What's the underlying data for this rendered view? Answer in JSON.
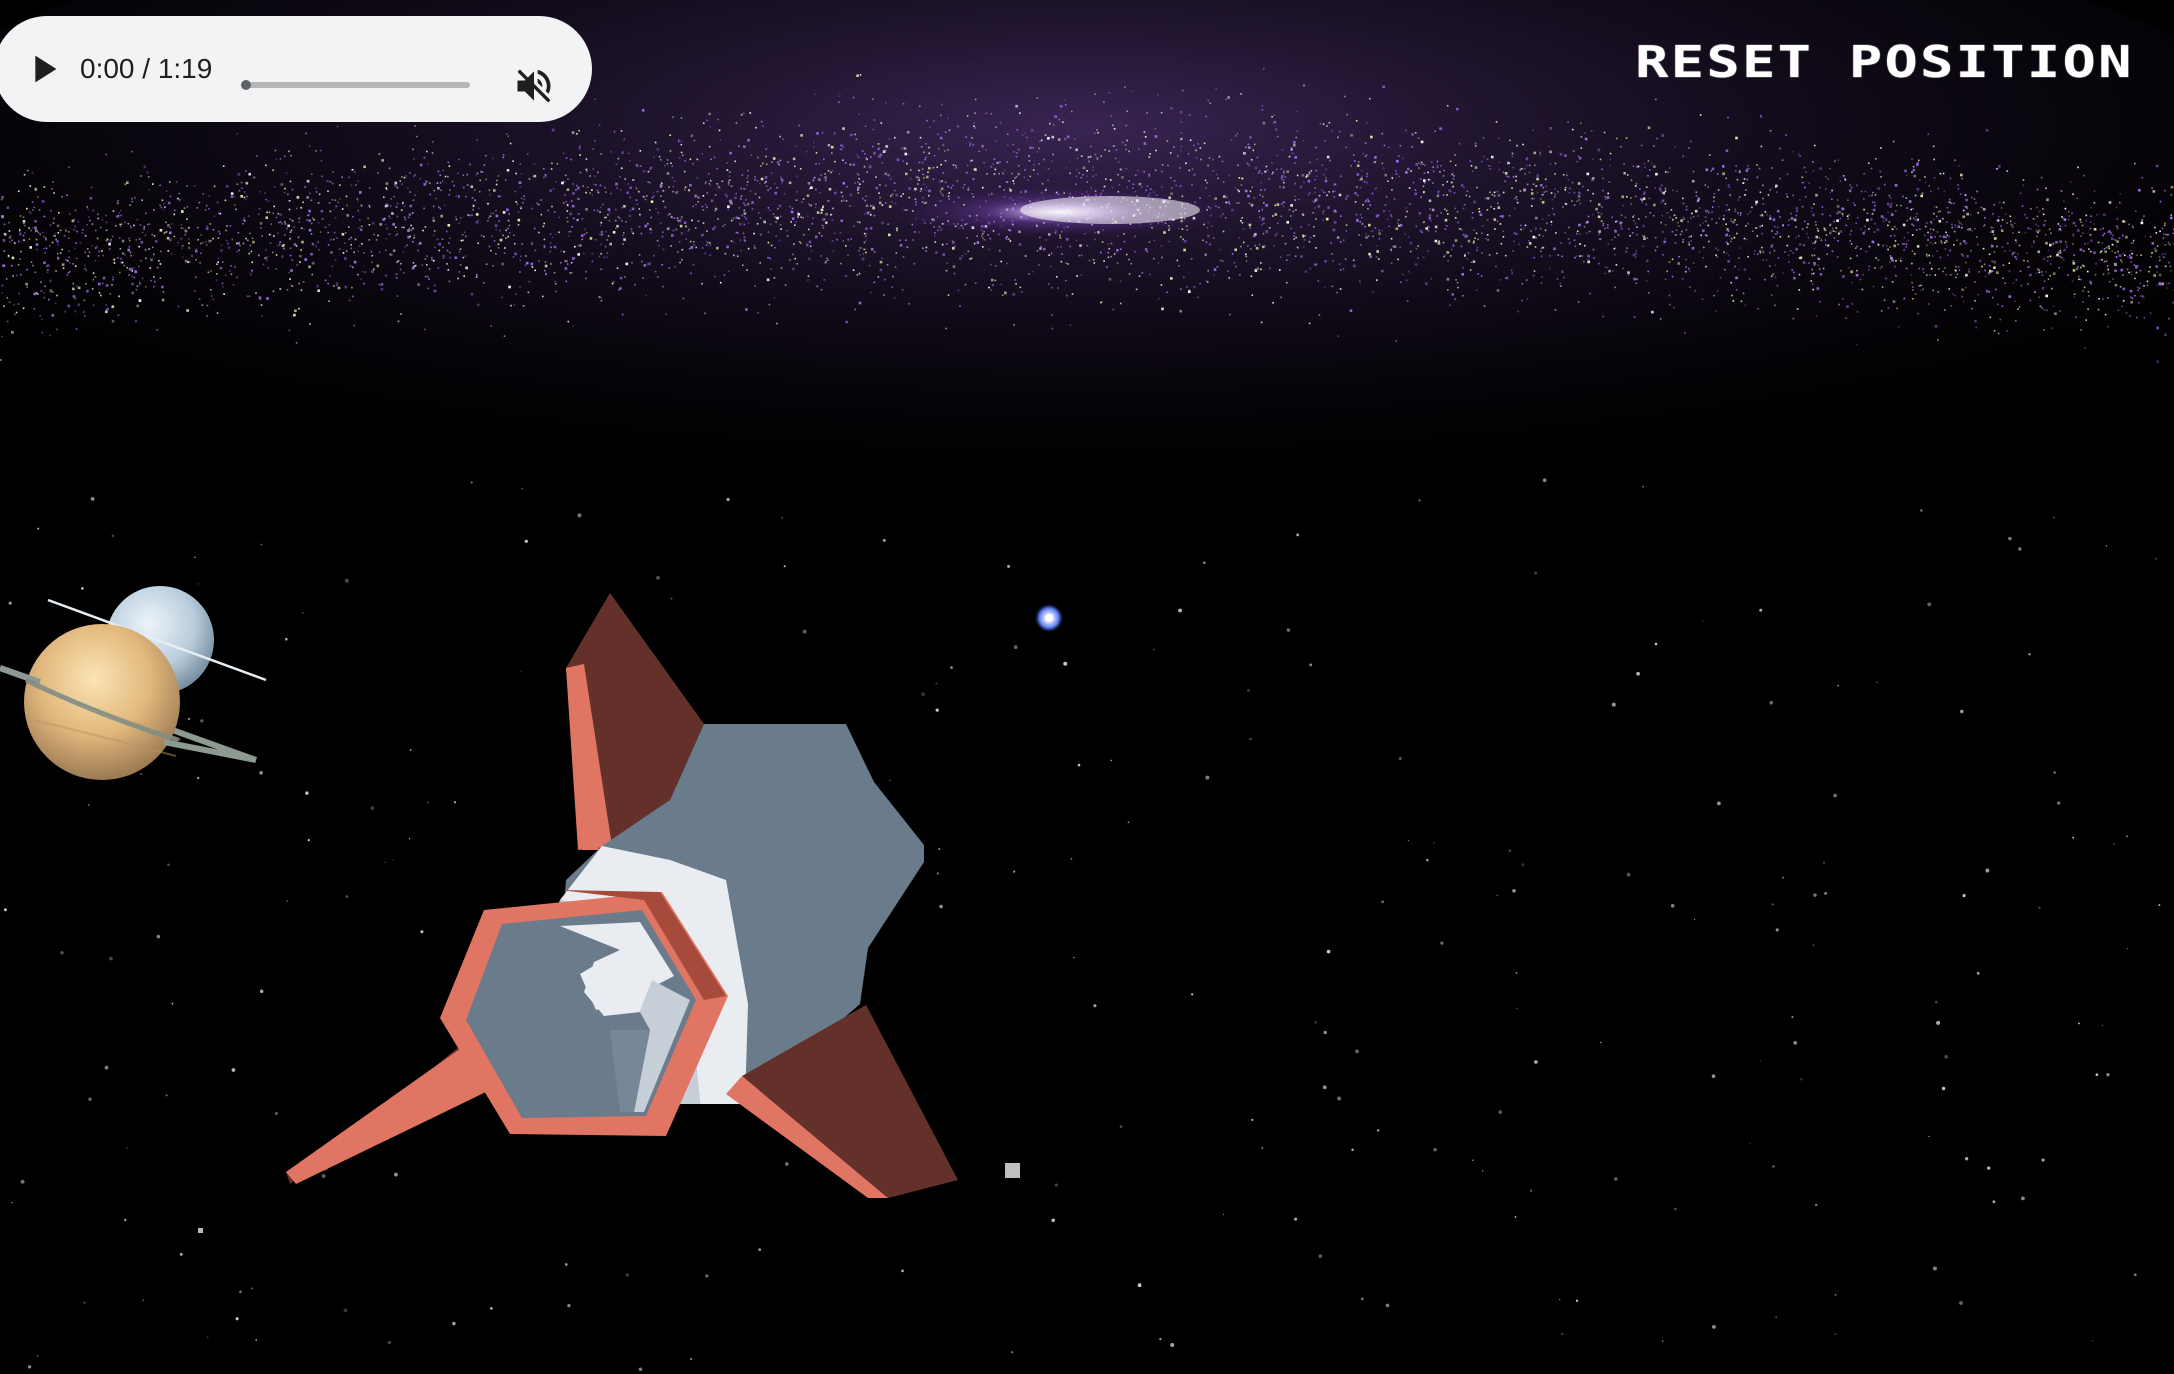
{
  "audio_player": {
    "time_display": "0:00 / 1:19",
    "progress": 0,
    "play_icon": "play-icon",
    "mute_icon": "volume-off-icon"
  },
  "controls": {
    "reset_label": "RESET POSITION"
  },
  "scene": {
    "objects": [
      "galaxy",
      "rocket",
      "saturn-planet",
      "uranus-planet",
      "blue-star"
    ],
    "colors": {
      "background": "#000000",
      "galaxy_purple": "#a36cf0",
      "galaxy_yellow": "#e8f0b0",
      "rocket_body": "#6a7b8b",
      "rocket_fin_dark": "#63312a",
      "rocket_fin_light": "#e07563",
      "rocket_trim": "#e9edf2",
      "saturn": "#e6c08a",
      "uranus": "#b8ccdc",
      "star_blue": "#6f8dff"
    }
  }
}
